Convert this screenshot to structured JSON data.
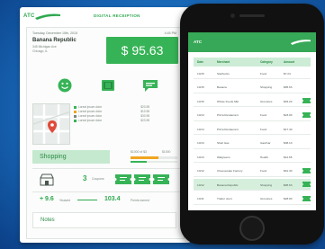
{
  "colors": {
    "accent": "#36b356",
    "accent_light": "#c5e9cf",
    "background": "#1c73c4"
  },
  "receipt_panel": {
    "logo": "ATC",
    "title": "DIGITAL RECEIPTION",
    "date": "Tuesday, December 15th, 2015",
    "time": "4:45 PM",
    "merchant": "Banana Republic",
    "address_lines": [
      "345 Michigan Ave",
      "Chicago, IL"
    ],
    "amount": "$ 95.63",
    "icons": [
      "smiley-icon",
      "wallet-icon",
      "chat-bubble-icon"
    ],
    "legend": [
      {
        "label": "Loreal ipsum dolor",
        "value": "$23.98",
        "color": "#36b356"
      },
      {
        "label": "Loreal ipsum dolor",
        "value": "$13.98",
        "color": "#f0a520"
      },
      {
        "label": "Loreal ipsum dolor",
        "value": "$33.98",
        "color": "#7c887f"
      },
      {
        "label": "Loreal ipsum dolor",
        "value": "$23.98",
        "color": "#36b356"
      }
    ],
    "category": "Shopping",
    "budget_label": "$1000 of $3",
    "budget_value": "$1000",
    "budget_progress": 0.6,
    "budget_progress_2": 0.35,
    "points": "3",
    "points_unit": "Coupons",
    "saving_a": "+ 9.6",
    "saving_a_unit": "%saved",
    "saving_b": "103.4",
    "saving_b_unit": "Points earned",
    "notes": "Notes"
  },
  "phone": {
    "app_label": "ATC",
    "columns": [
      "Date",
      "Merchant",
      "Category",
      "Amount"
    ],
    "rows": [
      {
        "date": "10/15",
        "merchant": "Starbucks",
        "category": "Food",
        "amount": "$7.24",
        "receipt": false,
        "highlight": false
      },
      {
        "date": "10/15",
        "merchant": "Banana",
        "category": "Shopping",
        "amount": "$95.63",
        "receipt": false,
        "highlight": false
      },
      {
        "date": "10/15",
        "merchant": "Whole Foods Mkt",
        "category": "Groceries",
        "amount": "$45.20",
        "receipt": true,
        "highlight": false
      },
      {
        "date": "10/14",
        "merchant": "Pizza Restaurant",
        "category": "Food",
        "amount": "$23.00",
        "receipt": true,
        "highlight": false
      },
      {
        "date": "10/14",
        "merchant": "Pizza Restaurant",
        "category": "Food",
        "amount": "$17.40",
        "receipt": false,
        "highlight": false
      },
      {
        "date": "10/13",
        "merchant": "Shell Gas",
        "category": "Gas/Car",
        "amount": "$38.10",
        "receipt": false,
        "highlight": false
      },
      {
        "date": "10/13",
        "merchant": "Walgreens",
        "category": "Health",
        "amount": "$12.65",
        "receipt": false,
        "highlight": false
      },
      {
        "date": "10/12",
        "merchant": "Cheesecake Factory",
        "category": "Food",
        "amount": "$61.30",
        "receipt": true,
        "highlight": false
      },
      {
        "date": "10/12",
        "merchant": "Banana Republic",
        "category": "Shopping",
        "amount": "$95.63",
        "receipt": true,
        "highlight": true
      },
      {
        "date": "10/11",
        "merchant": "Trader Joe's",
        "category": "Groceries",
        "amount": "$28.90",
        "receipt": true,
        "highlight": false
      }
    ]
  }
}
